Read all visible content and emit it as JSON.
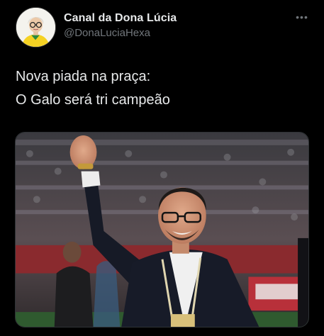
{
  "tweet": {
    "author": {
      "display_name": "Canal da Dona Lúcia",
      "handle": "@DonaLuciaHexa"
    },
    "more_icon": "ellipsis-icon",
    "text_lines": [
      "Nova piada na praça:",
      "O Galo será tri campeão"
    ],
    "media": {
      "kind": "photo"
    }
  },
  "colors": {
    "background": "#000000",
    "primary_text": "#e7e9ea",
    "secondary_text": "#71767b"
  }
}
